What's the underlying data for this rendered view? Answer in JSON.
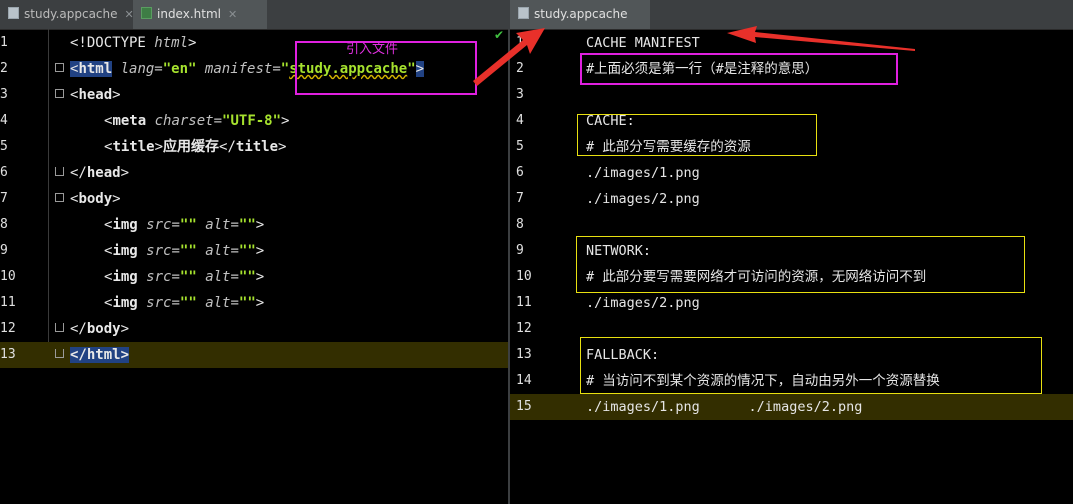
{
  "left": {
    "tabs": [
      {
        "label": "study.appcache",
        "active": false
      },
      {
        "label": "index.html",
        "active": true
      }
    ],
    "line_numbers": [
      "1",
      "2",
      "3",
      "4",
      "5",
      "6",
      "7",
      "8",
      "9",
      "10",
      "11",
      "12",
      "13"
    ],
    "annotation": "引入文件",
    "current_line": 13,
    "code": {
      "l1_doctype": "<!DOCTYPE ",
      "l1_html": "html",
      "l1_end": ">",
      "l2_open": "<",
      "l2_tag": "html",
      "l2_lang_attr": "lang=",
      "l2_lang_val": "\"en\"",
      "l2_manifest_attr": "manifest=",
      "l2_q1": "\"",
      "l2_manifest_val": "study.appcache",
      "l2_q2": "\"",
      "l2_end": ">",
      "l3_open": "<",
      "l3_tag": "head",
      "l3_end": ">",
      "l4_open": "<",
      "l4_tag": "meta",
      "l4_attr": "charset=",
      "l4_val": "\"UTF-8\"",
      "l4_end": ">",
      "l5_open": "<",
      "l5_tag": "title",
      "l5_mid": ">",
      "l5_text": "应用缓存",
      "l5_close_open": "</",
      "l5_close_tag": "title",
      "l5_end": ">",
      "l6_open": "</",
      "l6_tag": "head",
      "l6_end": ">",
      "l7_open": "<",
      "l7_tag": "body",
      "l7_end": ">",
      "img_open": "<",
      "img_tag": "img",
      "img_src_attr": "src=",
      "img_src_val": "\"\"",
      "img_alt_attr": "alt=",
      "img_alt_val": "\"\"",
      "img_end": ">",
      "l12_open": "</",
      "l12_tag": "body",
      "l12_end": ">",
      "l13_text": "</html>"
    }
  },
  "right": {
    "tabs": [
      {
        "label": "study.appcache",
        "active": true
      }
    ],
    "line_numbers": [
      "1",
      "2",
      "3",
      "4",
      "5",
      "6",
      "7",
      "8",
      "9",
      "10",
      "11",
      "12",
      "13",
      "14",
      "15"
    ],
    "current_line": 15,
    "lines": [
      "CACHE MANIFEST",
      "#上面必须是第一行（#是注释的意思）",
      "",
      "CACHE:",
      "# 此部分写需要缓存的资源",
      "./images/1.png",
      "./images/2.png",
      "",
      "NETWORK:",
      "# 此部分要写需要网络才可访问的资源，无网络访问不到",
      "./images/2.png",
      "",
      "FALLBACK:",
      "# 当访问不到某个资源的情况下，自动由另外一个资源替换",
      "./images/1.png      ./images/2.png"
    ]
  },
  "colors": {
    "annotation_magenta": "#e020e0",
    "annotation_yellow": "#e8e010",
    "arrow_red": "#e8302a",
    "current_line_bg": "#332e00",
    "string_green": "#a6e22e"
  }
}
